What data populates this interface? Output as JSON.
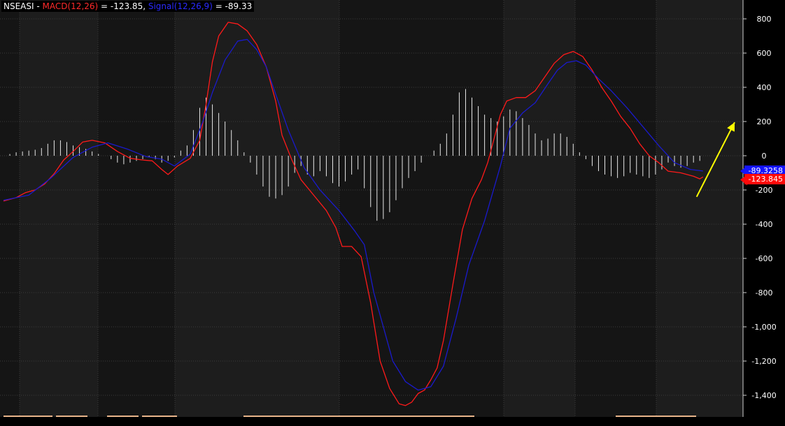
{
  "header": {
    "symbol": "NSEASI",
    "sep1": " - ",
    "macd_label": "MACD(12,26)",
    "macd_value_text": " = -123.85, ",
    "signal_label": "Signal(12,26,9)",
    "signal_value_text": " = -89.33"
  },
  "price_tags": {
    "signal": "-89.3258",
    "macd": "-123.845"
  },
  "colors": {
    "background": "#000000",
    "band_dark": "#151515",
    "band_light": "#1d1d1d",
    "grid": "#3a3a3a",
    "macd": "#ff1a1a",
    "signal": "#1a1acc",
    "histogram": "#e8e8e8",
    "annotation_arrow": "#ffff00",
    "volume_strip": "#e8b48a"
  },
  "chart_data": {
    "type": "line",
    "title": "",
    "ylim": [
      -1450,
      900
    ],
    "yticks": [
      800,
      600,
      400,
      200,
      0,
      -200,
      -400,
      -600,
      -800,
      -1000,
      -1200,
      -1400
    ],
    "ytick_labels": [
      "800",
      "600",
      "400",
      "200",
      "0",
      "-200",
      "-400",
      "-600",
      "-800",
      "-1,000",
      "-1,200",
      "-1,400"
    ],
    "grid": true,
    "series": [
      {
        "name": "MACD(12,26)",
        "points": [
          [
            0,
            -265
          ],
          [
            8,
            -245
          ],
          [
            14,
            -215
          ],
          [
            20,
            -200
          ],
          [
            26,
            -165
          ],
          [
            32,
            -105
          ],
          [
            38,
            -25
          ],
          [
            44,
            25
          ],
          [
            50,
            80
          ],
          [
            56,
            90
          ],
          [
            64,
            75
          ],
          [
            72,
            25
          ],
          [
            80,
            -15
          ],
          [
            88,
            -25
          ],
          [
            94,
            -30
          ],
          [
            100,
            -80
          ],
          [
            104,
            -110
          ],
          [
            110,
            -60
          ],
          [
            118,
            -15
          ],
          [
            124,
            90
          ],
          [
            128,
            300
          ],
          [
            132,
            550
          ],
          [
            136,
            700
          ],
          [
            142,
            780
          ],
          [
            148,
            770
          ],
          [
            154,
            730
          ],
          [
            160,
            650
          ],
          [
            166,
            520
          ],
          [
            172,
            320
          ],
          [
            176,
            120
          ],
          [
            182,
            -20
          ],
          [
            188,
            -140
          ],
          [
            196,
            -230
          ],
          [
            204,
            -320
          ],
          [
            210,
            -420
          ],
          [
            214,
            -530
          ],
          [
            220,
            -530
          ],
          [
            226,
            -590
          ],
          [
            232,
            -860
          ],
          [
            238,
            -1200
          ],
          [
            244,
            -1360
          ],
          [
            250,
            -1450
          ],
          [
            254,
            -1460
          ],
          [
            258,
            -1440
          ],
          [
            262,
            -1390
          ],
          [
            266,
            -1370
          ],
          [
            270,
            -1310
          ],
          [
            274,
            -1240
          ],
          [
            278,
            -1080
          ],
          [
            284,
            -750
          ],
          [
            290,
            -430
          ],
          [
            296,
            -250
          ],
          [
            302,
            -140
          ],
          [
            306,
            -40
          ],
          [
            310,
            100
          ],
          [
            314,
            240
          ],
          [
            318,
            320
          ],
          [
            324,
            340
          ],
          [
            330,
            340
          ],
          [
            336,
            380
          ],
          [
            342,
            460
          ],
          [
            348,
            540
          ],
          [
            354,
            590
          ],
          [
            360,
            610
          ],
          [
            366,
            580
          ],
          [
            372,
            500
          ],
          [
            378,
            400
          ],
          [
            384,
            320
          ],
          [
            390,
            230
          ],
          [
            396,
            160
          ],
          [
            402,
            70
          ],
          [
            408,
            0
          ],
          [
            414,
            -40
          ],
          [
            420,
            -90
          ],
          [
            428,
            -100
          ],
          [
            436,
            -120
          ],
          [
            440,
            -135
          ],
          [
            442,
            -123.85
          ]
        ]
      },
      {
        "name": "Signal(12,26,9)",
        "points": [
          [
            0,
            -260
          ],
          [
            16,
            -230
          ],
          [
            30,
            -130
          ],
          [
            44,
            -10
          ],
          [
            56,
            50
          ],
          [
            66,
            75
          ],
          [
            78,
            40
          ],
          [
            90,
            -5
          ],
          [
            100,
            -20
          ],
          [
            108,
            -60
          ],
          [
            118,
            10
          ],
          [
            126,
            200
          ],
          [
            132,
            370
          ],
          [
            140,
            560
          ],
          [
            148,
            670
          ],
          [
            154,
            680
          ],
          [
            160,
            620
          ],
          [
            166,
            520
          ],
          [
            172,
            360
          ],
          [
            180,
            150
          ],
          [
            190,
            -70
          ],
          [
            200,
            -200
          ],
          [
            212,
            -320
          ],
          [
            222,
            -440
          ],
          [
            228,
            -520
          ],
          [
            234,
            -800
          ],
          [
            240,
            -1000
          ],
          [
            246,
            -1200
          ],
          [
            254,
            -1320
          ],
          [
            262,
            -1370
          ],
          [
            270,
            -1350
          ],
          [
            278,
            -1230
          ],
          [
            286,
            -950
          ],
          [
            294,
            -640
          ],
          [
            304,
            -380
          ],
          [
            314,
            -60
          ],
          [
            320,
            160
          ],
          [
            328,
            250
          ],
          [
            336,
            310
          ],
          [
            344,
            420
          ],
          [
            350,
            500
          ],
          [
            356,
            545
          ],
          [
            362,
            555
          ],
          [
            368,
            530
          ],
          [
            376,
            450
          ],
          [
            384,
            380
          ],
          [
            394,
            280
          ],
          [
            404,
            170
          ],
          [
            414,
            60
          ],
          [
            424,
            -40
          ],
          [
            434,
            -80
          ],
          [
            442,
            -89.33
          ]
        ]
      },
      {
        "name": "Histogram",
        "style": "bars",
        "points": [
          [
            4,
            10
          ],
          [
            8,
            20
          ],
          [
            12,
            25
          ],
          [
            16,
            30
          ],
          [
            20,
            35
          ],
          [
            24,
            45
          ],
          [
            28,
            70
          ],
          [
            32,
            90
          ],
          [
            36,
            90
          ],
          [
            40,
            80
          ],
          [
            44,
            60
          ],
          [
            48,
            50
          ],
          [
            52,
            40
          ],
          [
            56,
            25
          ],
          [
            60,
            10
          ],
          [
            64,
            0
          ],
          [
            68,
            -20
          ],
          [
            72,
            -40
          ],
          [
            76,
            -50
          ],
          [
            80,
            -40
          ],
          [
            84,
            -30
          ],
          [
            88,
            -20
          ],
          [
            92,
            -10
          ],
          [
            96,
            -20
          ],
          [
            100,
            -40
          ],
          [
            104,
            -30
          ],
          [
            108,
            -10
          ],
          [
            112,
            30
          ],
          [
            116,
            60
          ],
          [
            120,
            150
          ],
          [
            124,
            280
          ],
          [
            128,
            340
          ],
          [
            132,
            300
          ],
          [
            136,
            250
          ],
          [
            140,
            200
          ],
          [
            144,
            150
          ],
          [
            148,
            90
          ],
          [
            152,
            20
          ],
          [
            156,
            -40
          ],
          [
            160,
            -110
          ],
          [
            164,
            -180
          ],
          [
            168,
            -240
          ],
          [
            172,
            -250
          ],
          [
            176,
            -230
          ],
          [
            180,
            -180
          ],
          [
            184,
            -100
          ],
          [
            188,
            -60
          ],
          [
            192,
            -110
          ],
          [
            196,
            -120
          ],
          [
            200,
            -90
          ],
          [
            204,
            -120
          ],
          [
            208,
            -160
          ],
          [
            212,
            -180
          ],
          [
            216,
            -150
          ],
          [
            220,
            -110
          ],
          [
            224,
            -80
          ],
          [
            228,
            -190
          ],
          [
            232,
            -300
          ],
          [
            236,
            -380
          ],
          [
            240,
            -370
          ],
          [
            244,
            -330
          ],
          [
            248,
            -260
          ],
          [
            252,
            -190
          ],
          [
            256,
            -130
          ],
          [
            260,
            -90
          ],
          [
            264,
            -40
          ],
          [
            268,
            0
          ],
          [
            272,
            30
          ],
          [
            276,
            70
          ],
          [
            280,
            130
          ],
          [
            284,
            240
          ],
          [
            288,
            370
          ],
          [
            292,
            390
          ],
          [
            296,
            340
          ],
          [
            300,
            290
          ],
          [
            304,
            240
          ],
          [
            308,
            220
          ],
          [
            312,
            200
          ],
          [
            316,
            230
          ],
          [
            320,
            270
          ],
          [
            324,
            260
          ],
          [
            328,
            220
          ],
          [
            332,
            180
          ],
          [
            336,
            130
          ],
          [
            340,
            90
          ],
          [
            344,
            100
          ],
          [
            348,
            130
          ],
          [
            352,
            130
          ],
          [
            356,
            110
          ],
          [
            360,
            70
          ],
          [
            364,
            20
          ],
          [
            368,
            -20
          ],
          [
            372,
            -60
          ],
          [
            376,
            -90
          ],
          [
            380,
            -110
          ],
          [
            384,
            -120
          ],
          [
            388,
            -130
          ],
          [
            392,
            -120
          ],
          [
            396,
            -100
          ],
          [
            400,
            -110
          ],
          [
            404,
            -120
          ],
          [
            408,
            -130
          ],
          [
            412,
            -110
          ],
          [
            416,
            -80
          ],
          [
            420,
            -40
          ],
          [
            424,
            -60
          ],
          [
            428,
            -70
          ],
          [
            432,
            -60
          ],
          [
            436,
            -40
          ],
          [
            440,
            -30
          ]
        ]
      }
    ],
    "annotations": [
      {
        "type": "arrow",
        "from": [
          438,
          -240
        ],
        "to": [
          462,
          195
        ],
        "color": "#ffff00"
      }
    ],
    "x_range": [
      0,
      462
    ]
  }
}
